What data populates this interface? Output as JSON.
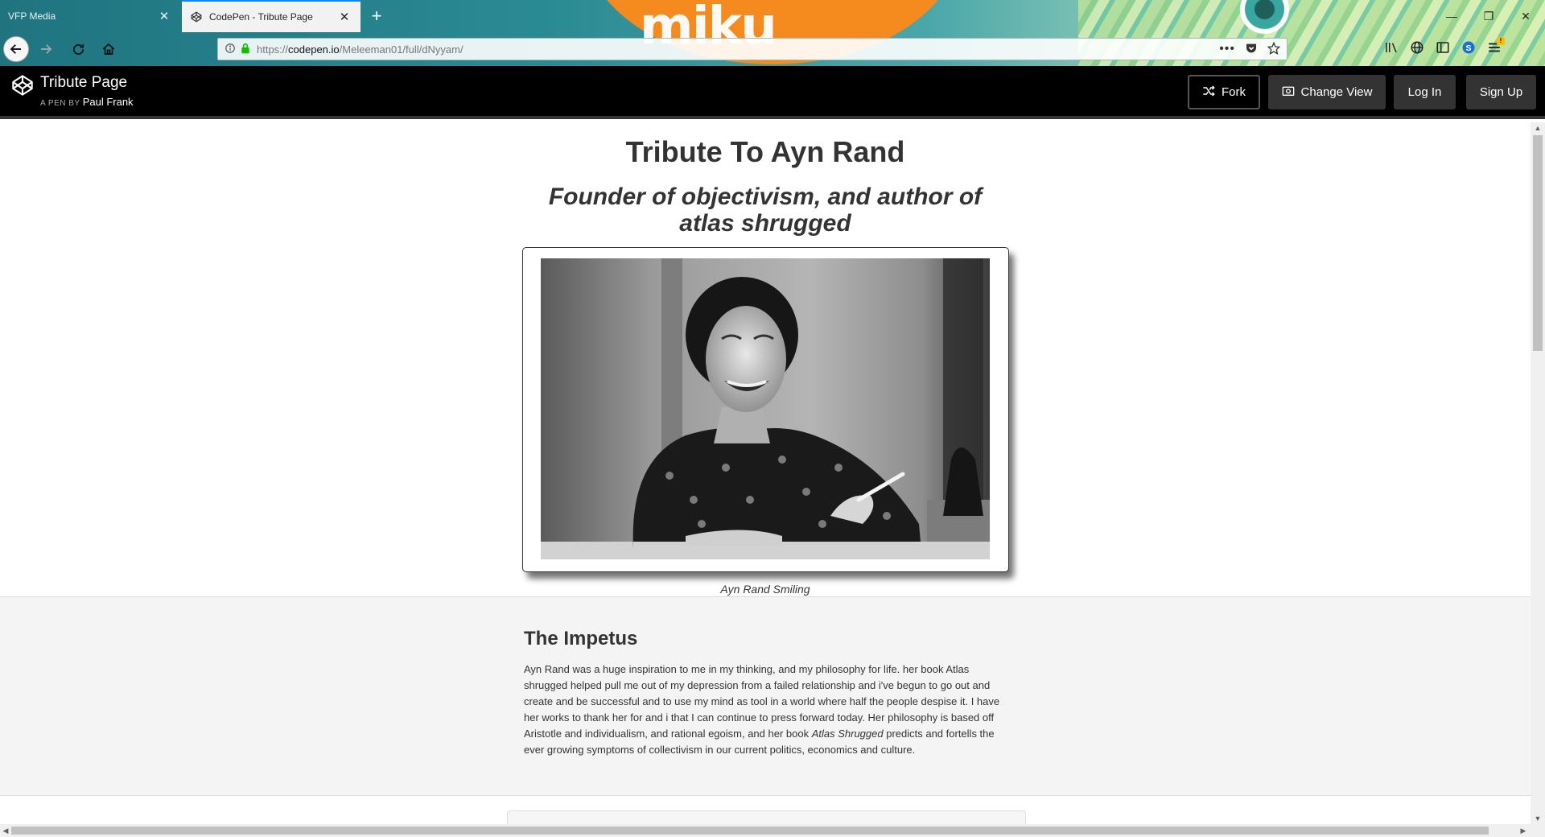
{
  "browser": {
    "tabs": [
      {
        "title": "VFP Media",
        "active": false
      },
      {
        "title": "CodePen - Tribute Page",
        "active": true
      }
    ],
    "url": {
      "scheme": "https://",
      "host": "codepen.io",
      "path": "/Meleeman01/full/dNyyam/"
    },
    "theme_logo_text": "miku",
    "notification_badge": "!"
  },
  "codepen": {
    "pen_title": "Tribute Page",
    "byline_prefix": "A PEN BY",
    "author": "Paul Frank",
    "buttons": {
      "fork": "Fork",
      "change_view": "Change View",
      "login": "Log In",
      "signup": "Sign Up"
    }
  },
  "page": {
    "title": "Tribute To Ayn Rand",
    "subtitle": "Founder of objectivism, and author of atlas shrugged",
    "image_caption": "Ayn Rand Smiling",
    "impetus_heading": "The Impetus",
    "impetus_text_1": "Ayn Rand was a huge inspiration to me in my thinking, and my philosophy for life. her book Atlas shrugged helped pull me out of my depression from a failed relationship and i've begun to go out and create and be successful and to use my mind as tool in a world where half the people despise it. I have her works to thank her for and i that I can continue to press forward today. Her philosophy is based off Aristotle and individualism, and rational egoism, and her book ",
    "impetus_book_title": "Atlas Shrugged",
    "impetus_text_2": " predicts and fortells the ever growing symptoms of collectivism in our current politics, economics and culture."
  },
  "colors": {
    "codepen_header": "#000000",
    "content_band": "#f4f4f4",
    "browser_accent": "#0a84ff",
    "theme_orange": "#f58a1f"
  }
}
